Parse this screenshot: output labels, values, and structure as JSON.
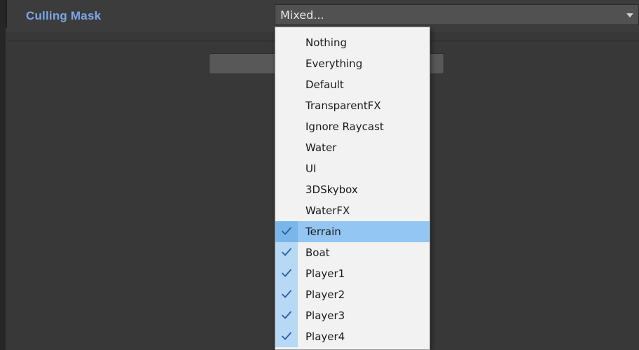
{
  "field": {
    "label": "Culling Mask",
    "value": "Mixed..."
  },
  "menu": {
    "items": [
      {
        "label": "Nothing",
        "checked": false,
        "highlighted": false
      },
      {
        "label": "Everything",
        "checked": false,
        "highlighted": false
      },
      {
        "label": "Default",
        "checked": false,
        "highlighted": false
      },
      {
        "label": "TransparentFX",
        "checked": false,
        "highlighted": false
      },
      {
        "label": "Ignore Raycast",
        "checked": false,
        "highlighted": false
      },
      {
        "label": "Water",
        "checked": false,
        "highlighted": false
      },
      {
        "label": "UI",
        "checked": false,
        "highlighted": false
      },
      {
        "label": "3DSkybox",
        "checked": false,
        "highlighted": false
      },
      {
        "label": "WaterFX",
        "checked": false,
        "highlighted": false
      },
      {
        "label": "Terrain",
        "checked": true,
        "highlighted": true
      },
      {
        "label": "Boat",
        "checked": true,
        "highlighted": false
      },
      {
        "label": "Player1",
        "checked": true,
        "highlighted": false
      },
      {
        "label": "Player2",
        "checked": true,
        "highlighted": false
      },
      {
        "label": "Player3",
        "checked": true,
        "highlighted": false
      },
      {
        "label": "Player4",
        "checked": true,
        "highlighted": false
      }
    ]
  },
  "colors": {
    "label_accent": "#7aa7e6",
    "highlight": "#93c6f2",
    "check_column": "#b8d9f5",
    "check_mark": "#2a5d9f"
  }
}
